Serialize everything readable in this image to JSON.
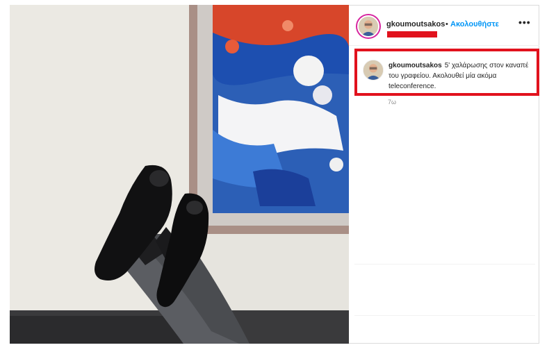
{
  "post": {
    "username": "gkoumoutsakos",
    "separator": "•",
    "follow_label": "Ακολουθήστε",
    "more_label": "•••"
  },
  "caption": {
    "username": "gkoumoutsakos",
    "text": "5' χαλάρωσης στον καναπέ του γραφείου. Ακολουθεί μία ακόμα teleconference.",
    "time": "7ω"
  },
  "colors": {
    "follow": "#0095f6",
    "highlight": "#e1121d",
    "story_ring": "#d6249f"
  },
  "icons": {
    "more": "more-options-icon",
    "avatar": "profile-avatar"
  }
}
